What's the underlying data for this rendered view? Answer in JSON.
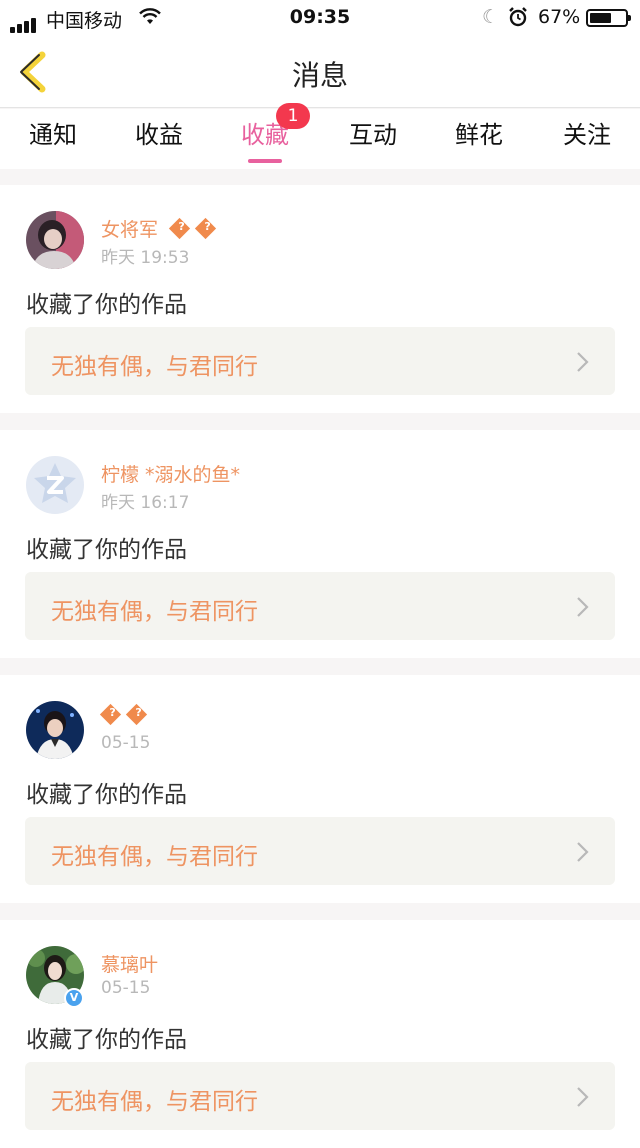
{
  "status_bar": {
    "carrier": "中国移动",
    "time": "09:35",
    "battery": "67%",
    "battery_level": 0.67
  },
  "header": {
    "title": "消息"
  },
  "tabs": [
    {
      "label": "通知"
    },
    {
      "label": "收益"
    },
    {
      "label": "收藏",
      "active": true,
      "badge": "1"
    },
    {
      "label": "互动"
    },
    {
      "label": "鲜花"
    },
    {
      "label": "关注"
    }
  ],
  "messages": [
    {
      "user": "女将军",
      "medals": 2,
      "time": "昨天 19:53",
      "action": "收藏了你的作品",
      "work": "无独有偶，与君同行",
      "avatar": "photo-dark"
    },
    {
      "user": "柠檬 *溺水的鱼*",
      "medals": 0,
      "time": "昨天 16:17",
      "action": "收藏了你的作品",
      "work": "无独有偶，与君同行",
      "avatar": "default-qzone"
    },
    {
      "user": "",
      "medals": 2,
      "time": "05-15",
      "action": "收藏了你的作品",
      "work": "无独有偶，与君同行",
      "avatar": "photo-stage"
    },
    {
      "user": "慕璃叶",
      "medals": 0,
      "time": "05-15",
      "action": "收藏了你的作品",
      "work": "无独有偶，与君同行",
      "avatar": "photo-green",
      "verified": true
    }
  ],
  "colors": {
    "accent": "#e8619e",
    "badge": "#f3384e",
    "username": "#ee9462",
    "card_link_bg": "#f4f4f0",
    "back_arrow": "#f4d33a"
  }
}
